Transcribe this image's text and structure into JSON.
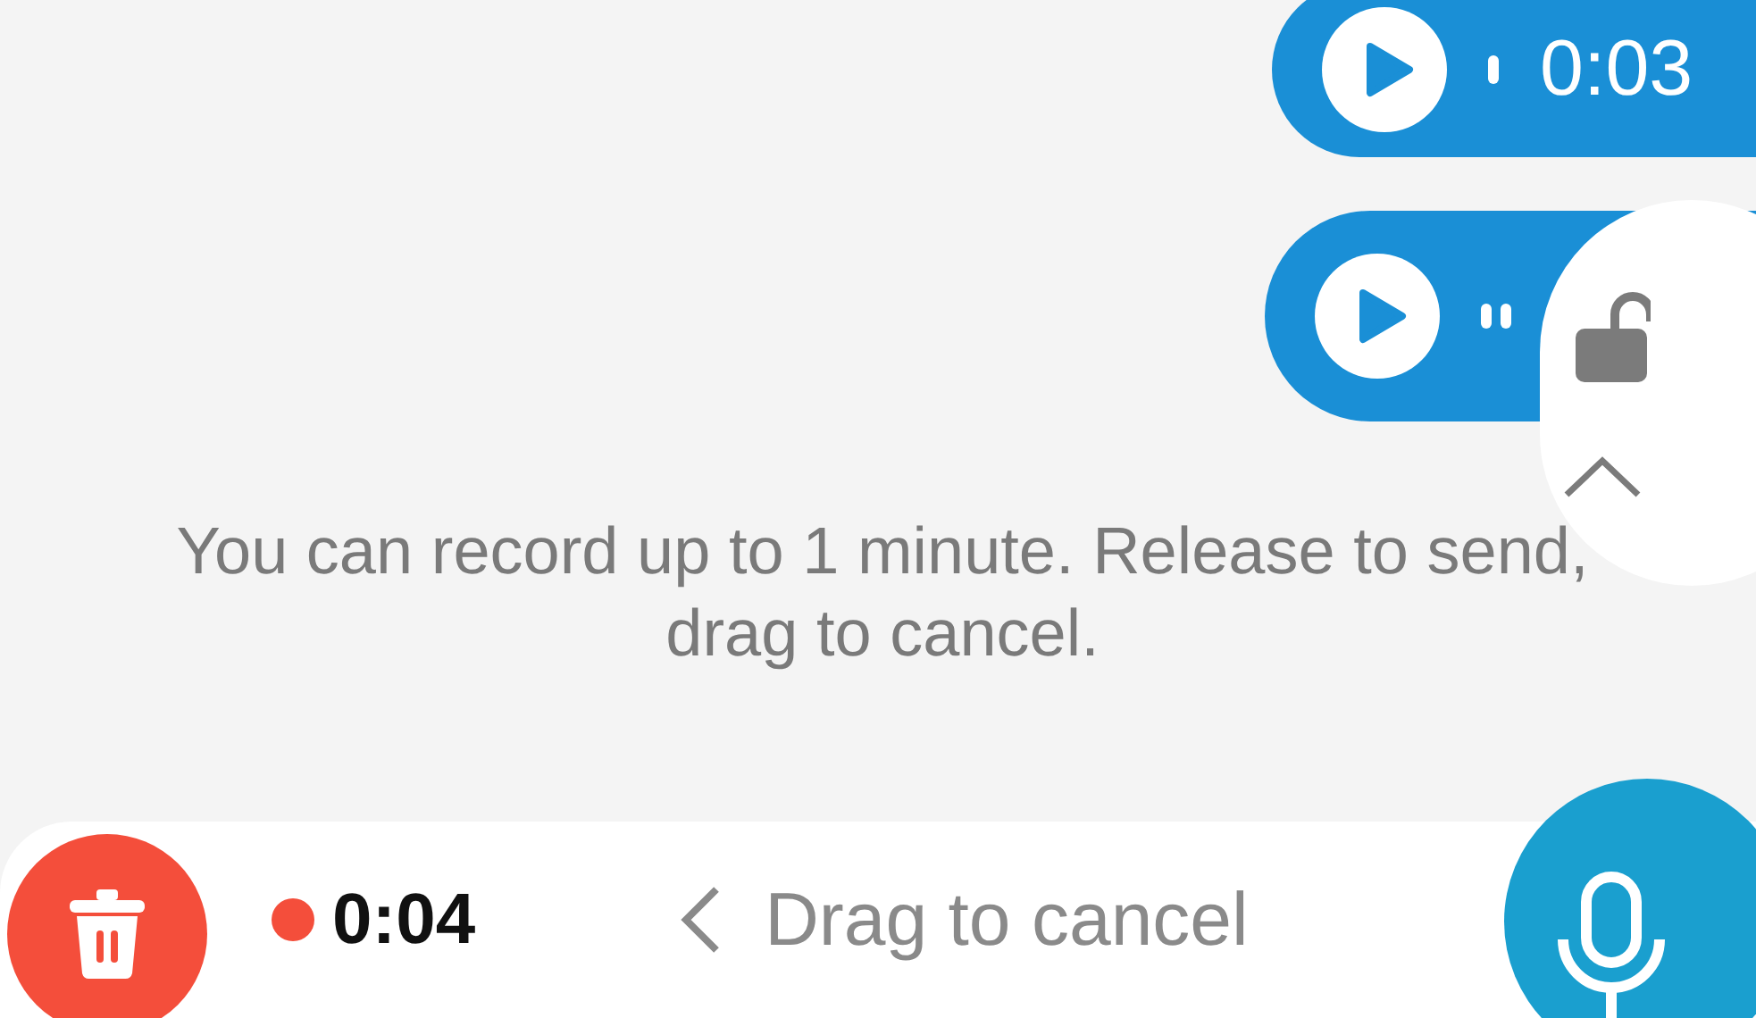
{
  "messages": [
    {
      "kind": "voice",
      "duration": "0:03"
    },
    {
      "kind": "voice"
    }
  ],
  "hint": "You can record up to 1 minute. Release to send, drag to cancel.",
  "recorder": {
    "timer": "0:04",
    "slide_hint": "Drag to cancel"
  }
}
